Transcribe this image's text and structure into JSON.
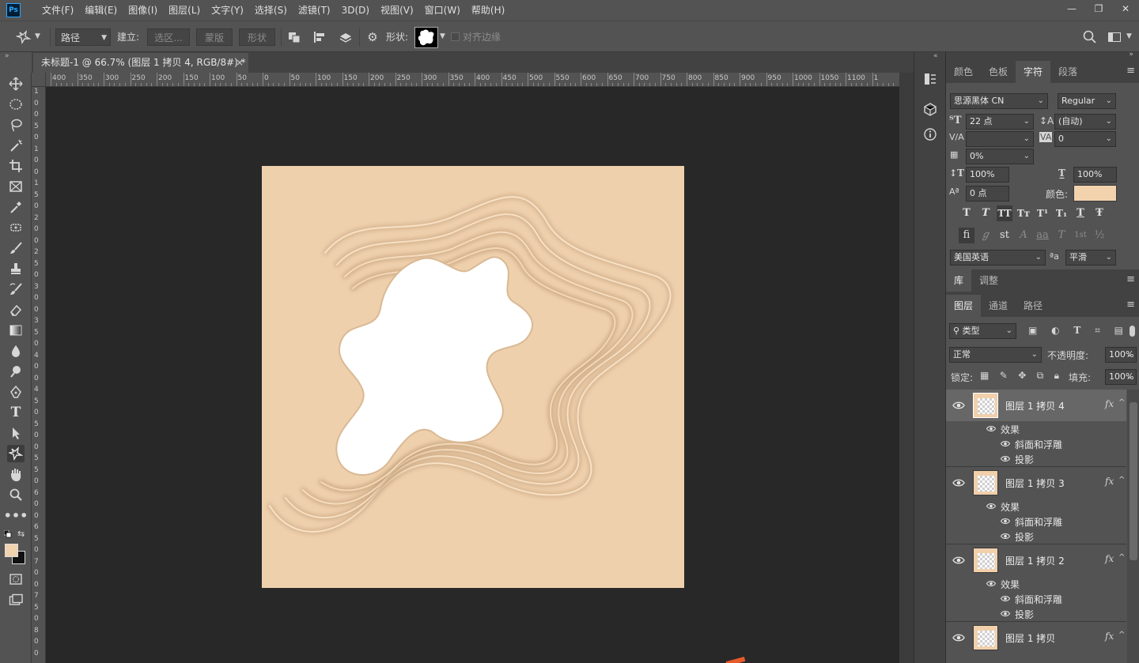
{
  "app": {
    "logo": "Ps"
  },
  "menu": [
    "文件(F)",
    "编辑(E)",
    "图像(I)",
    "图层(L)",
    "文字(Y)",
    "选择(S)",
    "滤镜(T)",
    "3D(D)",
    "视图(V)",
    "窗口(W)",
    "帮助(H)"
  ],
  "window_controls": {
    "minimize": "—",
    "restore": "❐",
    "close": "✕"
  },
  "options": {
    "mode_value": "路径",
    "make_label": "建立:",
    "selection_button": "选区...",
    "mask_button": "蒙版",
    "shape_button": "形状",
    "shape_label": "形状:",
    "align_edges": "对齐边缘"
  },
  "document_tab": {
    "title": "未标题-1 @ 66.7% (图层 1 拷贝 4, RGB/8#) *",
    "close": "×"
  },
  "ruler": {
    "h_labels": [
      "400",
      "350",
      "300",
      "250",
      "200",
      "150",
      "100",
      "50",
      "0",
      "50",
      "100",
      "150",
      "200",
      "250",
      "300",
      "350",
      "400",
      "450",
      "500",
      "550",
      "600",
      "650",
      "700",
      "750",
      "800",
      "850",
      "900",
      "950",
      "1000",
      "1050",
      "1100",
      "1"
    ],
    "v_labels": [
      "1",
      "0",
      "0",
      "5",
      "0",
      "1",
      "0",
      "0",
      "1",
      "5",
      "0",
      "2",
      "0",
      "0",
      "2",
      "5",
      "0",
      "3",
      "0",
      "0",
      "3",
      "5",
      "0",
      "4",
      "0",
      "0",
      "4",
      "5",
      "0",
      "5",
      "0",
      "0",
      "5",
      "5",
      "0",
      "6",
      "0",
      "0",
      "6",
      "5",
      "0",
      "7",
      "0",
      "0",
      "7",
      "5",
      "0",
      "8",
      "0",
      "0"
    ]
  },
  "colors": {
    "foreground": "#f0d2ae",
    "background": "#111111",
    "canvas": "#efd0ad",
    "accent": "#31a8ff"
  },
  "character_panel": {
    "tabs": [
      "颜色",
      "色板",
      "字符",
      "段落"
    ],
    "active_tab": "字符",
    "font_family": "思源黑体 CN",
    "font_style": "Regular",
    "font_size": "22 点",
    "leading": "(自动)",
    "kerning": "",
    "tracking": "0",
    "tsume": "0%",
    "vertical_scale": "100%",
    "horizontal_scale": "100%",
    "baseline_shift": "0 点",
    "color_label": "颜色:",
    "text_color": "#f2d3ae",
    "style_glyphs": [
      "T",
      "T",
      "TT",
      "Tт",
      "T¹",
      "T₁",
      "T",
      "Ŧ"
    ],
    "opentype_glyphs": [
      "fi",
      "ℊ",
      "st",
      "A",
      "aa",
      "T",
      "1st",
      "½"
    ],
    "language": "美国英语",
    "aa_label": "ªa",
    "antialias": "平滑"
  },
  "library_tabs": [
    "库",
    "调整"
  ],
  "layers_panel": {
    "tabs": [
      "图层",
      "通道",
      "路径"
    ],
    "filter_kind": "类型",
    "blend_mode": "正常",
    "opacity_label": "不透明度:",
    "opacity": "100%",
    "lock_label": "锁定:",
    "fill_label": "填充:",
    "fill": "100%",
    "layers": [
      {
        "name": "图层 1 拷贝 4",
        "selected": true,
        "fx": "fx",
        "effects_label": "效果",
        "effects": [
          "斜面和浮雕",
          "投影"
        ]
      },
      {
        "name": "图层 1 拷贝 3",
        "selected": false,
        "fx": "fx",
        "effects_label": "效果",
        "effects": [
          "斜面和浮雕",
          "投影"
        ]
      },
      {
        "name": "图层 1 拷贝 2",
        "selected": false,
        "fx": "fx",
        "effects_label": "效果",
        "effects": [
          "斜面和浮雕",
          "投影"
        ]
      },
      {
        "name": "图层 1 拷贝",
        "selected": false,
        "fx": "fx",
        "effects_label": "效果",
        "effects": []
      }
    ]
  }
}
